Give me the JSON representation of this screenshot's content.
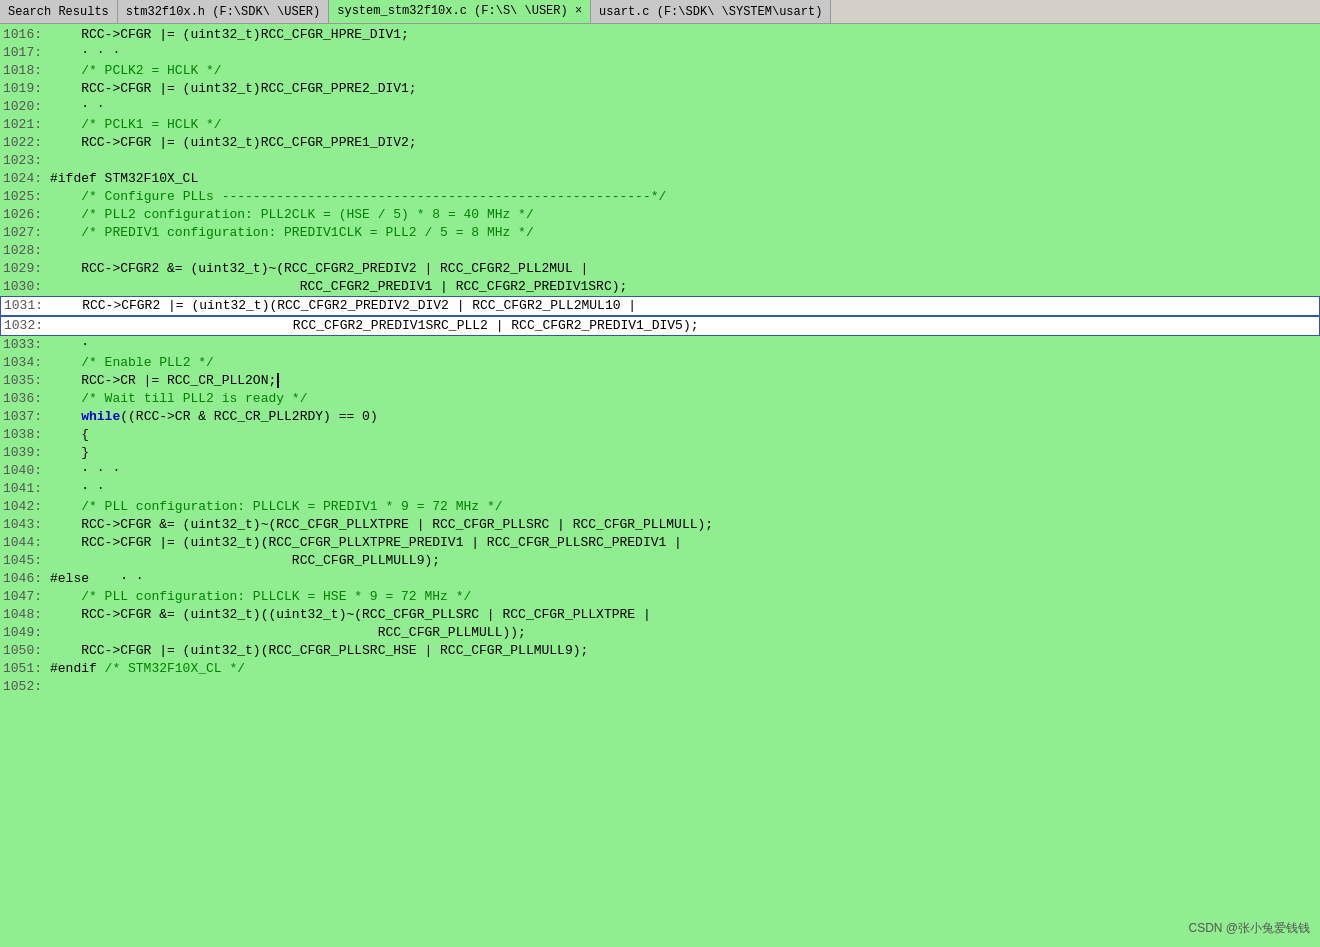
{
  "tabs": [
    {
      "label": "Search Results",
      "active": false,
      "highlighted": false
    },
    {
      "label": "stm32f10x.h (F:\\SDK\\                \\USER)",
      "active": false,
      "highlighted": false
    },
    {
      "label": "system_stm32f10x.c (F:\\S\\                \\USER) ×",
      "active": true,
      "highlighted": false
    },
    {
      "label": "usart.c (F:\\SDK\\                \\SYSTEM\\usart)",
      "active": false,
      "highlighted": false
    }
  ],
  "lines": [
    {
      "num": "1016:",
      "content": "    RCC->CFGR |= (uint32_t)RCC_CFGR_HPRE_DIV1;"
    },
    {
      "num": "1017:",
      "content": "    · · ·"
    },
    {
      "num": "1018:",
      "content": "    /* PCLK2 = HCLK */"
    },
    {
      "num": "1019:",
      "content": "    RCC->CFGR |= (uint32_t)RCC_CFGR_PPRE2_DIV1;"
    },
    {
      "num": "1020:",
      "content": "    · ·"
    },
    {
      "num": "1021:",
      "content": "    /* PCLK1 = HCLK */"
    },
    {
      "num": "1022:",
      "content": "    RCC->CFGR |= (uint32_t)RCC_CFGR_PPRE1_DIV2;"
    },
    {
      "num": "1023:",
      "content": ""
    },
    {
      "num": "1024:",
      "content": "#ifdef STM32F10X_CL",
      "keyword": true
    },
    {
      "num": "1025:",
      "content": "    /* Configure PLLs -------------------------------------------------------*/"
    },
    {
      "num": "1026:",
      "content": "    /* PLL2 configuration: PLL2CLK = (HSE / 5) * 8 = 40 MHz */"
    },
    {
      "num": "1027:",
      "content": "    /* PREDIV1 configuration: PREDIV1CLK = PLL2 / 5 = 8 MHz */"
    },
    {
      "num": "1028:",
      "content": ""
    },
    {
      "num": "1029:",
      "content": "    RCC->CFGR2 &= (uint32_t)~(RCC_CFGR2_PREDIV2 | RCC_CFGR2_PLL2MUL |"
    },
    {
      "num": "1030:",
      "content": "                                RCC_CFGR2_PREDIV1 | RCC_CFGR2_PREDIV1SRC);"
    },
    {
      "num": "1031:",
      "content": "    RCC->CFGR2 |= (uint32_t)(RCC_CFGR2_PREDIV2_DIV2 | RCC_CFGR2_PLL2MUL10 |",
      "selected": true
    },
    {
      "num": "1032:",
      "content": "                               RCC_CFGR2_PREDIV1SRC_PLL2 | RCC_CFGR2_PREDIV1_DIV5);",
      "selected": true
    },
    {
      "num": "1033:",
      "content": "    ·"
    },
    {
      "num": "1034:",
      "content": "    /* Enable PLL2 */"
    },
    {
      "num": "1035:",
      "content": "    RCC->CR |= RCC_CR_PLL2ON;",
      "cursor": true
    },
    {
      "num": "1036:",
      "content": "    /* Wait till PLL2 is ready */"
    },
    {
      "num": "1037:",
      "content": "    while((RCC->CR & RCC_CR_PLL2RDY) == 0)",
      "bold": true
    },
    {
      "num": "1038:",
      "content": "    {"
    },
    {
      "num": "1039:",
      "content": "    }"
    },
    {
      "num": "1040:",
      "content": "    · · ·"
    },
    {
      "num": "1041:",
      "content": "    · ·"
    },
    {
      "num": "1042:",
      "content": "    /* PLL configuration: PLLCLK = PREDIV1 * 9 = 72 MHz */"
    },
    {
      "num": "1043:",
      "content": "    RCC->CFGR &= (uint32_t)~(RCC_CFGR_PLLXTPRE | RCC_CFGR_PLLSRC | RCC_CFGR_PLLMULL);"
    },
    {
      "num": "1044:",
      "content": "    RCC->CFGR |= (uint32_t)(RCC_CFGR_PLLXTPRE_PREDIV1 | RCC_CFGR_PLLSRC_PREDIV1 |"
    },
    {
      "num": "1045:",
      "content": "                               RCC_CFGR_PLLMULL9);"
    },
    {
      "num": "1046:",
      "content": "#else    · ·",
      "keyword": true
    },
    {
      "num": "1047:",
      "content": "    /* PLL configuration: PLLCLK = HSE * 9 = 72 MHz */"
    },
    {
      "num": "1048:",
      "content": "    RCC->CFGR &= (uint32_t)((uint32_t)~(RCC_CFGR_PLLSRC | RCC_CFGR_PLLXTPRE |"
    },
    {
      "num": "1049:",
      "content": "                                          RCC_CFGR_PLLMULL));"
    },
    {
      "num": "1050:",
      "content": "    RCC->CFGR |= (uint32_t)(RCC_CFGR_PLLSRC_HSE | RCC_CFGR_PLLMULL9);"
    },
    {
      "num": "1051:",
      "content": "#endif /* STM32F10X_CL */",
      "keyword": true
    },
    {
      "num": "1052:",
      "content": ""
    }
  ],
  "watermark": "CSDN @张小兔爱钱钱"
}
